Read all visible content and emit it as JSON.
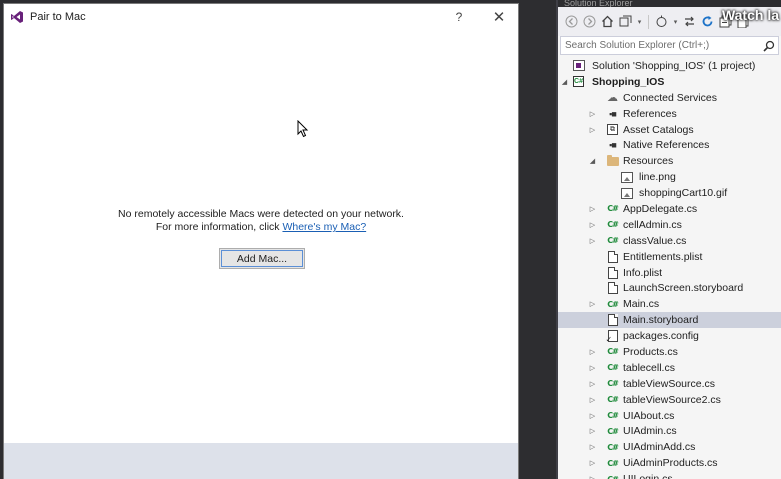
{
  "dialog": {
    "title": "Pair to Mac",
    "help_glyph": "?",
    "close_glyph": "✕",
    "message_line1": "No remotely accessible Macs were detected on your network.",
    "message_line2_prefix": "For more information, click ",
    "message_link": "Where's my Mac?",
    "add_mac_button": "Add Mac..."
  },
  "solution_explorer": {
    "header_title": "Solution Explorer",
    "overlay_text": "Watch la",
    "search_placeholder": "Search Solution Explorer (Ctrl+;)",
    "selected_item": "Main.storyboard",
    "items": [
      {
        "label": "Solution 'Shopping_IOS' (1 project)",
        "icon": "solution-icon",
        "level": 0,
        "expander": "none"
      },
      {
        "label": "Shopping_IOS",
        "icon": "project-icon",
        "level": 0,
        "expander": "expanded",
        "bold": true
      },
      {
        "label": "Connected Services",
        "icon": "connected-services-icon",
        "level": 1,
        "expander": "none"
      },
      {
        "label": "References",
        "icon": "references-icon",
        "level": 1,
        "expander": "collapsed"
      },
      {
        "label": "Asset Catalogs",
        "icon": "asset-catalog-icon",
        "level": 1,
        "expander": "collapsed"
      },
      {
        "label": "Native References",
        "icon": "references-icon",
        "level": 1,
        "expander": "none"
      },
      {
        "label": "Resources",
        "icon": "folder-icon",
        "level": 1,
        "expander": "expanded"
      },
      {
        "label": "line.png",
        "icon": "image-file-icon",
        "level": 2,
        "expander": "none"
      },
      {
        "label": "shoppingCart10.gif",
        "icon": "image-file-icon",
        "level": 2,
        "expander": "none"
      },
      {
        "label": "AppDelegate.cs",
        "icon": "csharp-file-icon",
        "level": 1,
        "expander": "collapsed"
      },
      {
        "label": "cellAdmin.cs",
        "icon": "csharp-file-icon",
        "level": 1,
        "expander": "collapsed"
      },
      {
        "label": "classValue.cs",
        "icon": "csharp-file-icon",
        "level": 1,
        "expander": "collapsed"
      },
      {
        "label": "Entitlements.plist",
        "icon": "document-icon",
        "level": 1,
        "expander": "none"
      },
      {
        "label": "Info.plist",
        "icon": "document-icon",
        "level": 1,
        "expander": "none"
      },
      {
        "label": "LaunchScreen.storyboard",
        "icon": "document-icon",
        "level": 1,
        "expander": "none"
      },
      {
        "label": "Main.cs",
        "icon": "csharp-file-icon",
        "level": 1,
        "expander": "collapsed"
      },
      {
        "label": "Main.storyboard",
        "icon": "document-icon",
        "level": 1,
        "expander": "none"
      },
      {
        "label": "packages.config",
        "icon": "config-file-icon",
        "level": 1,
        "expander": "none"
      },
      {
        "label": "Products.cs",
        "icon": "csharp-file-icon",
        "level": 1,
        "expander": "collapsed"
      },
      {
        "label": "tablecell.cs",
        "icon": "csharp-file-icon",
        "level": 1,
        "expander": "collapsed"
      },
      {
        "label": "tableViewSource.cs",
        "icon": "csharp-file-icon",
        "level": 1,
        "expander": "collapsed"
      },
      {
        "label": "tableViewSource2.cs",
        "icon": "csharp-file-icon",
        "level": 1,
        "expander": "collapsed"
      },
      {
        "label": "UIAbout.cs",
        "icon": "csharp-file-icon",
        "level": 1,
        "expander": "collapsed"
      },
      {
        "label": "UIAdmin.cs",
        "icon": "csharp-file-icon",
        "level": 1,
        "expander": "collapsed"
      },
      {
        "label": "UIAdminAdd.cs",
        "icon": "csharp-file-icon",
        "level": 1,
        "expander": "collapsed"
      },
      {
        "label": "UiAdminProducts.cs",
        "icon": "csharp-file-icon",
        "level": 1,
        "expander": "collapsed"
      },
      {
        "label": "UILogin.cs",
        "icon": "csharp-file-icon",
        "level": 1,
        "expander": "collapsed"
      }
    ]
  },
  "colors": {
    "selection": "#ccd0dc",
    "link": "#1a5fb4",
    "csharp_icon": "#1e8a3a",
    "dialog_footer": "#dde1ea"
  }
}
